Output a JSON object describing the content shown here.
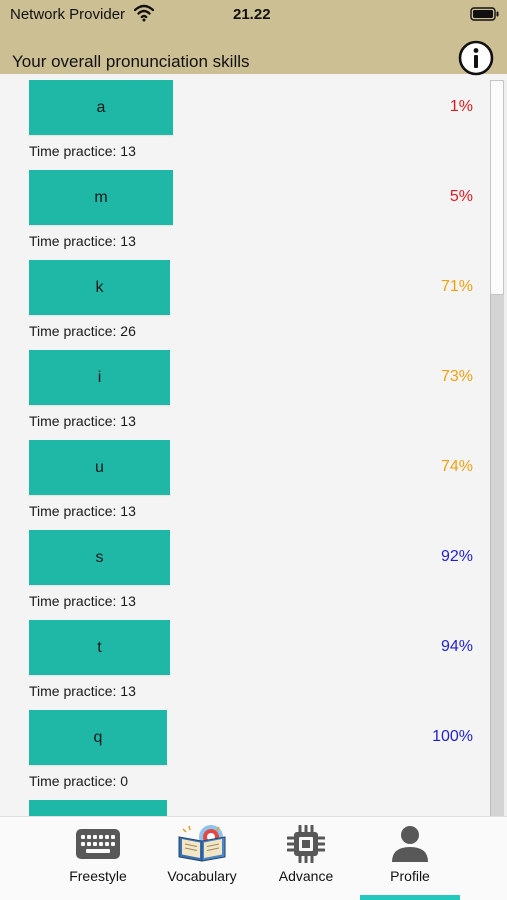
{
  "status_bar": {
    "carrier": "Network Provider",
    "time": "21.22"
  },
  "header": {
    "title": "Your overall pronunciation skills"
  },
  "colors": {
    "low": "#e0191f",
    "mid": "#f0a012",
    "high": "#1f1fd2",
    "accent": "#25c8bd",
    "button": "#1fb8a6"
  },
  "skills": [
    {
      "phoneme": "a",
      "percent": "1%",
      "time": "Time practice: 13",
      "level": "low"
    },
    {
      "phoneme": "m",
      "percent": "5%",
      "time": "Time practice: 13",
      "level": "low"
    },
    {
      "phoneme": "k",
      "percent": "71%",
      "time": "Time practice: 26",
      "level": "mid"
    },
    {
      "phoneme": "i",
      "percent": "73%",
      "time": "Time practice: 13",
      "level": "mid"
    },
    {
      "phoneme": "u",
      "percent": "74%",
      "time": "Time practice: 13",
      "level": "mid"
    },
    {
      "phoneme": "s",
      "percent": "92%",
      "time": "Time practice: 13",
      "level": "high"
    },
    {
      "phoneme": "t",
      "percent": "94%",
      "time": "Time practice: 13",
      "level": "high"
    },
    {
      "phoneme": "q",
      "percent": "100%",
      "time": "Time practice: 0",
      "level": "high"
    },
    {
      "phoneme": "",
      "percent": "",
      "time": "",
      "level": "high"
    }
  ],
  "tabs": [
    {
      "label": "Freestyle",
      "icon": "keyboard-icon",
      "active": false
    },
    {
      "label": "Vocabulary",
      "icon": "book-icon",
      "active": false
    },
    {
      "label": "Advance",
      "icon": "chip-icon",
      "active": false
    },
    {
      "label": "Profile",
      "icon": "person-icon",
      "active": true
    }
  ]
}
